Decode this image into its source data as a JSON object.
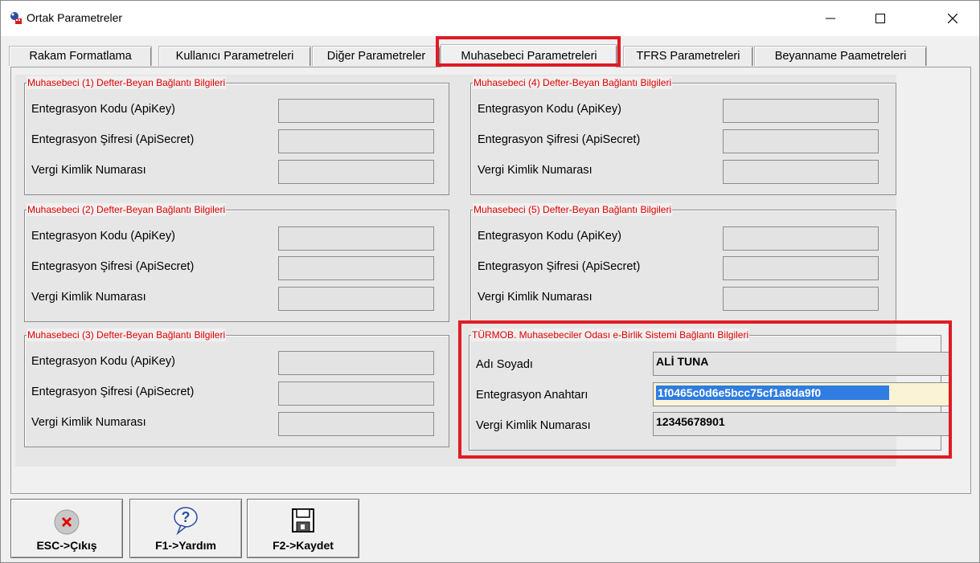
{
  "window": {
    "title": "Ortak Parametreler"
  },
  "tabs": [
    {
      "label": "Rakam Formatlama"
    },
    {
      "label": "Kullanıcı Parametreleri"
    },
    {
      "label": "Diğer Parametreler"
    },
    {
      "label": "Muhasebeci Parametreleri",
      "active": true
    },
    {
      "label": "TFRS Parametreleri"
    },
    {
      "label": "Beyanname Paametreleri"
    }
  ],
  "groups": {
    "g1": {
      "title": "Muhasebeci (1) Defter-Beyan Bağlantı Bilgileri"
    },
    "g2": {
      "title": "Muhasebeci (2) Defter-Beyan Bağlantı Bilgileri"
    },
    "g3": {
      "title": "Muhasebeci (3) Defter-Beyan Bağlantı Bilgileri"
    },
    "g4": {
      "title": "Muhasebeci (4) Defter-Beyan Bağlantı Bilgileri"
    },
    "g5": {
      "title": "Muhasebeci (5) Defter-Beyan Bağlantı Bilgileri"
    }
  },
  "labels": {
    "api_key": "Entegrasyon Kodu (ApiKey)",
    "api_secret": "Entegrasyon Şifresi (ApiSecret)",
    "tax_id": "Vergi Kimlik Numarası"
  },
  "turmob": {
    "title": "TÜRMOB. Muhasebeciler Odası e-Birlik Sistemi Bağlantı Bilgileri",
    "name_label": "Adı Soyadı",
    "name_value": "ALİ TUNA",
    "key_label": "Entegrasyon Anahtarı",
    "key_value": "1f0465c0d6e5bcc75cf1a8da9f0",
    "tax_label": "Vergi Kimlik Numarası",
    "tax_value": "12345678901"
  },
  "buttons": {
    "exit": "ESC->Çıkış",
    "help": "F1->Yardım",
    "save": "F2->Kaydet"
  },
  "colors": {
    "group_title": "#e00000",
    "highlight": "#e01b24",
    "selection": "#2f7de1"
  }
}
